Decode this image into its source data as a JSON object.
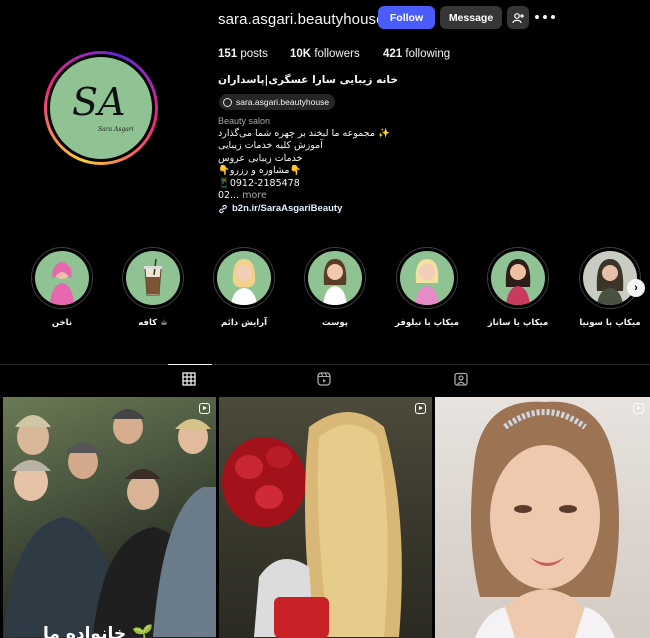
{
  "profile": {
    "username": "sara.asgari.beautyhouse",
    "follow_label": "Follow",
    "message_label": "Message",
    "avatar_text": "SA",
    "avatar_subtext": "Sara Asgari",
    "stats": {
      "posts_count": "151",
      "posts_label": "posts",
      "followers_count": "10K",
      "followers_label": "followers",
      "following_count": "421",
      "following_label": "following"
    },
    "full_name": "خانه زیبایی سارا عسگری|پاسداران",
    "threads_handle": "sara.asgari.beautyhouse",
    "category": "Beauty salon",
    "bio_lines": [
      "مجموعه ما لبخند بر چهره شما می‌گذارد ✨",
      "آموزش کلیه خدمات زیبایی",
      "خدمات زیبایی عروس",
      "👇مشاوره و رزرو👇",
      "📱0912-2185478"
    ],
    "bio_truncated": "02...",
    "bio_more": "more",
    "link": "b2n.ir/SaraAsgariBeauty"
  },
  "highlights": [
    {
      "label": "ناخن",
      "icon": "nail-avatar-icon"
    },
    {
      "label": "کافه ☕",
      "icon": "coffee-cup-icon"
    },
    {
      "label": "آرایش دائم",
      "icon": "permanent-makeup-avatar-icon"
    },
    {
      "label": "پوست",
      "icon": "skin-avatar-icon"
    },
    {
      "label": "میکاپ با نیلوفر",
      "icon": "makeup-niloufar-avatar-icon"
    },
    {
      "label": "میکاپ با ساناز",
      "icon": "makeup-sanaz-avatar-icon"
    },
    {
      "label": "میکاپ با سونیا",
      "icon": "makeup-sonia-avatar-icon"
    }
  ],
  "tabs": [
    {
      "name": "posts",
      "icon": "grid-icon",
      "active": true
    },
    {
      "name": "reels",
      "icon": "reels-icon",
      "active": false
    },
    {
      "name": "tagged",
      "icon": "tagged-icon",
      "active": false
    }
  ],
  "posts": [
    {
      "type": "reel",
      "caption": "خانواده ما 🌱"
    },
    {
      "type": "reel",
      "caption": ""
    },
    {
      "type": "reel",
      "caption": ""
    }
  ],
  "colors": {
    "background": "#000000",
    "follow_button": "#4a5df9",
    "secondary_button": "#363636",
    "avatar_green": "#8fc393",
    "link": "#e0f1ff",
    "muted": "#a8a8a8"
  }
}
